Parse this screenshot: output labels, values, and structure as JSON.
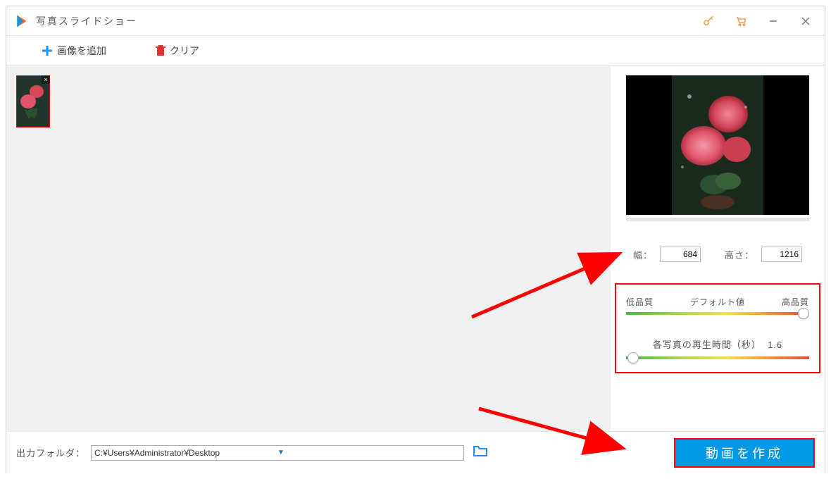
{
  "title": "写真スライドショー",
  "toolbar": {
    "add_image": "画像を追加",
    "clear": "クリア"
  },
  "dimensions": {
    "width_label": "幅：",
    "width_value": "684",
    "height_label": "高さ：",
    "height_value": "1216"
  },
  "quality": {
    "low": "低品質",
    "default": "デフォルト値",
    "high": "高品質",
    "handle_pct": 97
  },
  "duration": {
    "label": "各写真の再生時間（秒）",
    "value": "1.6",
    "handle_pct": 4
  },
  "footer": {
    "label": "出力フォルダ：",
    "path": "C:¥Users¥Administrator¥Desktop",
    "create": "動画を作成"
  }
}
